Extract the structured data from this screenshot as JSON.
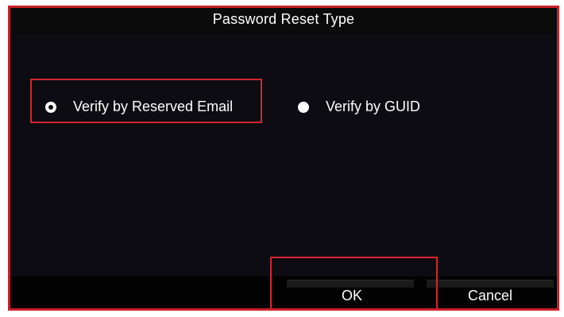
{
  "dialog": {
    "title": "Password Reset Type"
  },
  "options": [
    {
      "label": "Verify by Reserved Email",
      "selected": true
    },
    {
      "label": "Verify by GUID",
      "selected": false
    }
  ],
  "buttons": {
    "ok_label": "OK",
    "cancel_label": "Cancel"
  },
  "colors": {
    "highlight": "#d82530",
    "background": "#0c0c12",
    "text": "#ffffff"
  }
}
